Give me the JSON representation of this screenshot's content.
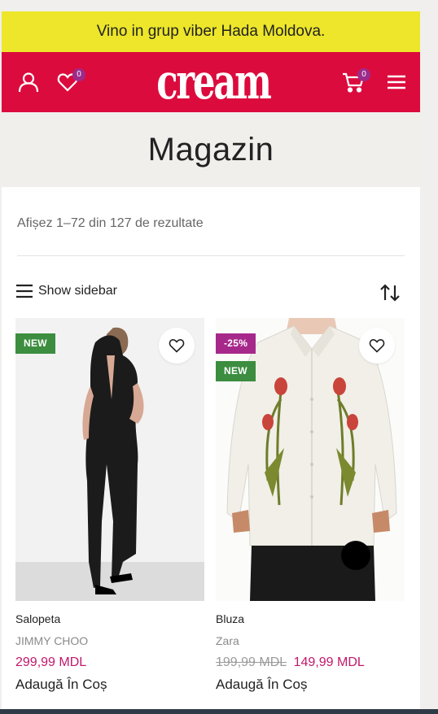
{
  "promo": {
    "text": "Vino in grup viber Hada Moldova."
  },
  "header": {
    "logo": "cream",
    "wishlist_count": "0",
    "cart_count": "0",
    "icons": [
      "user-icon",
      "heart-icon",
      "cart-icon",
      "menu-icon"
    ]
  },
  "page": {
    "title": "Magazin",
    "results": "Afișez 1–72 din 127 de rezultate",
    "sidebar_toggle": "Show sidebar"
  },
  "products": [
    {
      "name": "Salopeta",
      "brand": "JIMMY CHOO",
      "price": "299,99 MDL",
      "old_price": "",
      "badges": [
        "NEW"
      ],
      "add_label": "Adaugă În Coș"
    },
    {
      "name": "Bluza",
      "brand": "Zara",
      "price": "149,99 MDL",
      "old_price": "199,99 MDL",
      "badges": [
        "-25%",
        "NEW"
      ],
      "add_label": "Adaugă În Coș"
    }
  ],
  "colors": {
    "promo_bg": "#ede62a",
    "header_bg": "#dc0b3d",
    "badge_new": "#3c8d3f",
    "badge_sale": "#a7288b",
    "price": "#c2186b"
  }
}
